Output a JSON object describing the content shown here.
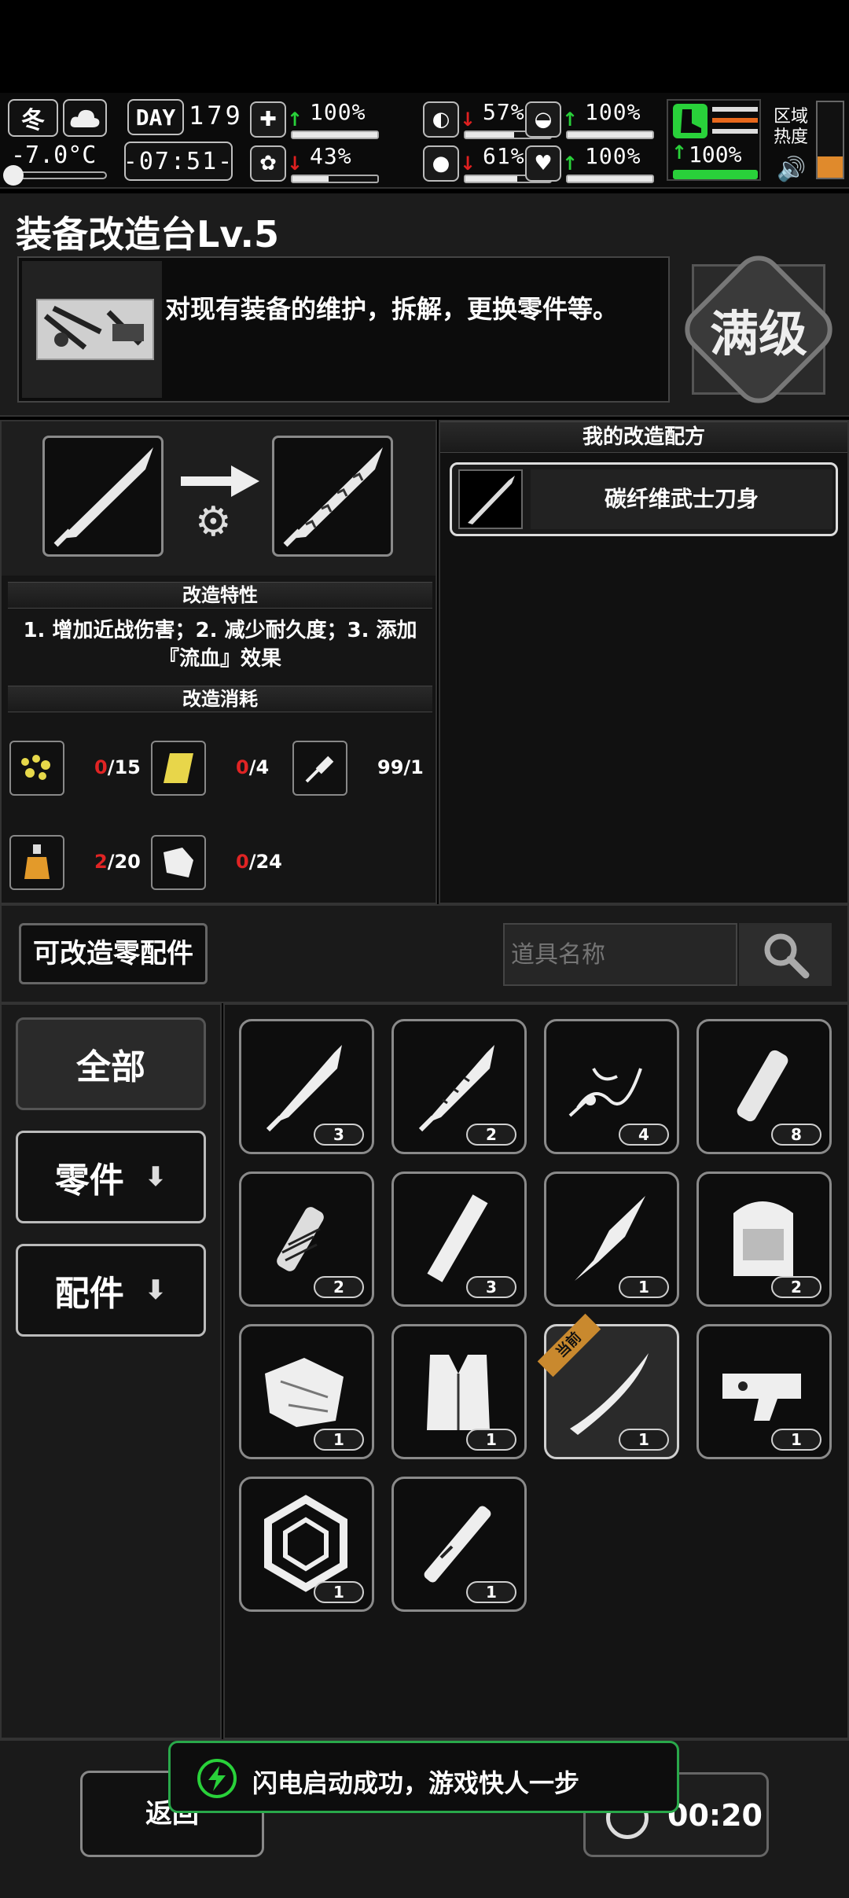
{
  "status": {
    "season": "冬",
    "temperature": "-7.0°C",
    "day_label": "DAY",
    "day": "179",
    "clock": "-07:51-",
    "stats": [
      {
        "name": "health",
        "icon": "medkit-icon",
        "dir": "up",
        "value": "100%",
        "level": 1.0
      },
      {
        "name": "hunger",
        "icon": "stomach-icon",
        "dir": "down",
        "value": "57%",
        "level": 0.57
      },
      {
        "name": "armor",
        "icon": "helmet-icon",
        "dir": "up",
        "value": "100%",
        "level": 1.0
      },
      {
        "name": "mood",
        "icon": "brain-icon",
        "dir": "down",
        "value": "43%",
        "level": 0.43
      },
      {
        "name": "thirst",
        "icon": "water-drop-icon",
        "dir": "down",
        "value": "61%",
        "level": 0.61
      },
      {
        "name": "heart",
        "icon": "heart-icon",
        "dir": "up",
        "value": "100%",
        "level": 1.0
      }
    ],
    "stamina": {
      "icon": "boot-icon",
      "dir": "up",
      "value": "100%",
      "level": 1.0
    },
    "zone_heat_label": "区域\n热度"
  },
  "workbench": {
    "title": "装备改造台Lv.5",
    "description": "对现有装备的维护，拆解，更换零件等。",
    "max_level_badge": "满级"
  },
  "modify": {
    "trait_header": "改造特性",
    "trait_text": "1. 增加近战伤害；2. 减少耐久度；3. 添加『流血』效果",
    "cost_header": "改造消耗",
    "costs": [
      {
        "icon": "scrap-pile-icon",
        "have": "0",
        "need": "/15"
      },
      {
        "icon": "gold-plate-icon",
        "have": "0",
        "need": "/4"
      },
      {
        "icon": "syringe-icon",
        "have": "99",
        "need": "/1"
      },
      {
        "icon": "potion-bottle-icon",
        "have": "2",
        "need": "/20"
      },
      {
        "icon": "cloth-icon",
        "have": "0",
        "need": "/24"
      }
    ]
  },
  "recipes": {
    "header": "我的改造配方",
    "items": [
      {
        "icon": "serrated-blade-icon",
        "label": "碳纤维武士刀身"
      }
    ]
  },
  "parts": {
    "tab_label": "可改造零配件",
    "search_placeholder": "道具名称",
    "categories": [
      {
        "label": "全部",
        "has_arrow": false
      },
      {
        "label": "零件",
        "has_arrow": true
      },
      {
        "label": "配件",
        "has_arrow": true
      }
    ],
    "current_tag": "当前",
    "items": [
      {
        "icon": "knife-blade-icon",
        "count": "3"
      },
      {
        "icon": "serrated-knife-icon",
        "count": "2"
      },
      {
        "icon": "wire-parts-icon",
        "count": "4"
      },
      {
        "icon": "wood-handle-icon",
        "count": "8"
      },
      {
        "icon": "wrapped-grip-icon",
        "count": "2"
      },
      {
        "icon": "metal-rod-icon",
        "count": "3"
      },
      {
        "icon": "spear-tip-icon",
        "count": "1"
      },
      {
        "icon": "backpack-icon",
        "count": "2"
      },
      {
        "icon": "cloth-armor-icon",
        "count": "1"
      },
      {
        "icon": "vest-icon",
        "count": "1"
      },
      {
        "icon": "katana-blade-icon",
        "count": "1",
        "current": true
      },
      {
        "icon": "trigger-mechanism-icon",
        "count": "1"
      },
      {
        "icon": "weight-plate-icon",
        "count": "1"
      },
      {
        "icon": "baton-icon",
        "count": "1"
      }
    ]
  },
  "footer": {
    "back_label": "返回",
    "timer": "00:20",
    "toast": "闪电启动成功，游戏快人一步"
  }
}
